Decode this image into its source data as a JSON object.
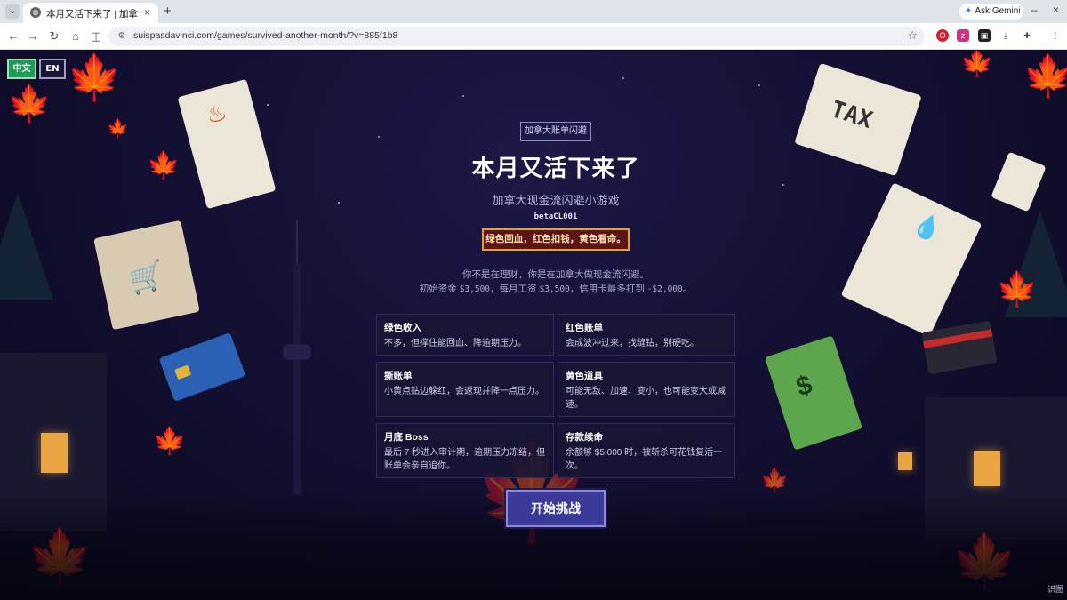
{
  "browser": {
    "tab_title": "本月又活下来了 | 加拿大现金流",
    "tab_close": "×",
    "new_tab": "+",
    "ask_gemini": "Ask Gemini",
    "url": "suispasdavinci.com/games/survived-another-month/?v=885f1b8"
  },
  "lang": {
    "zh": "中文",
    "en": "EN"
  },
  "hero": {
    "badge": "加拿大账单闪避",
    "title": "本月又活下来了",
    "subtitle": "加拿大现金流闪避小游戏",
    "version": "betaCL001",
    "hint": "绿色回血，红色扣钱，黄色看命。",
    "intro_line1": "你不是在理财，你是在加拿大做现金流闪避。",
    "intro_line2_a": "初始资金",
    "intro_start": "$3,500",
    "intro_line2_b": "，每月工资",
    "intro_salary": "$3,500",
    "intro_line2_c": "，信用卡最多打到",
    "intro_limit": "-$2,000",
    "intro_line2_d": "。"
  },
  "cards": [
    {
      "title": "绿色收入",
      "desc": "不多，但撑住能回血、降逾期压力。"
    },
    {
      "title": "红色账单",
      "desc": "会成波冲过来，找缝钻，别硬吃。"
    },
    {
      "title": "撕账单",
      "desc": "小黄点贴边躲红，会返现并降一点压力。"
    },
    {
      "title": "黄色道具",
      "desc": "可能无敌、加速、变小，也可能变大或减速。"
    },
    {
      "title": "月底 Boss",
      "desc": "最后 7 秒进入审计期，逾期压力冻结，但账单会亲自追你。"
    },
    {
      "title": "存款续命",
      "desc": "余额够 $5,000 时，被斩杀可花钱复活一次。"
    }
  ],
  "start_button": "开始挑战",
  "corner_mark": "识图"
}
